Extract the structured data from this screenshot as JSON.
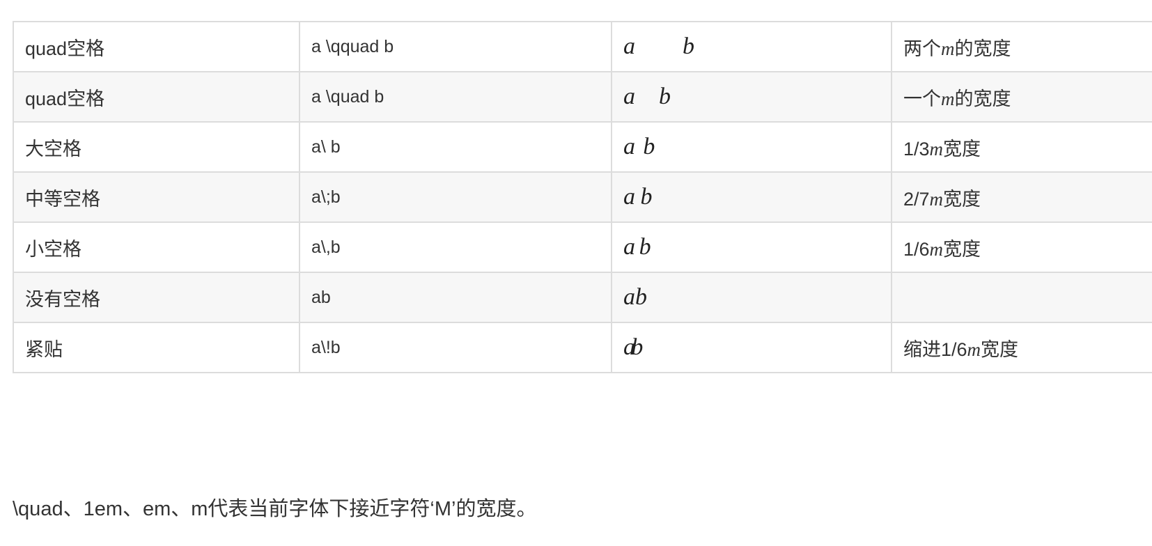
{
  "table": {
    "rows": [
      {
        "name": "quad空格",
        "code": "a \\qquad b",
        "render": {
          "left": "a",
          "right": "b",
          "space": "qquad"
        },
        "desc_prefix": "两个",
        "desc_m": "m",
        "desc_suffix": "的宽度"
      },
      {
        "name": "quad空格",
        "code": "a \\quad b",
        "render": {
          "left": "a",
          "right": "b",
          "space": "quad"
        },
        "desc_prefix": "一个",
        "desc_m": "m",
        "desc_suffix": "的宽度"
      },
      {
        "name": "大空格",
        "code": "a\\ b",
        "render": {
          "left": "a",
          "right": "b",
          "space": "large"
        },
        "desc_prefix": "1/3",
        "desc_m": "m",
        "desc_suffix": "宽度"
      },
      {
        "name": "中等空格",
        "code": "a\\;b",
        "render": {
          "left": "a",
          "right": "b",
          "space": "medium"
        },
        "desc_prefix": "2/7",
        "desc_m": "m",
        "desc_suffix": "宽度"
      },
      {
        "name": "小空格",
        "code": "a\\,b",
        "render": {
          "left": "a",
          "right": "b",
          "space": "small"
        },
        "desc_prefix": "1/6",
        "desc_m": "m",
        "desc_suffix": "宽度"
      },
      {
        "name": "没有空格",
        "code": "ab",
        "render": {
          "left": "a",
          "right": "b",
          "space": "none"
        },
        "desc_prefix": "",
        "desc_m": "",
        "desc_suffix": ""
      },
      {
        "name": "紧贴",
        "code": "a\\!b",
        "render": {
          "left": "a",
          "right": "b",
          "space": "negative"
        },
        "desc_prefix": "缩进1/6",
        "desc_m": "m",
        "desc_suffix": "宽度"
      }
    ]
  },
  "footnote": "\\quad、1em、em、m代表当前字体下接近字符‘M’的宽度。"
}
